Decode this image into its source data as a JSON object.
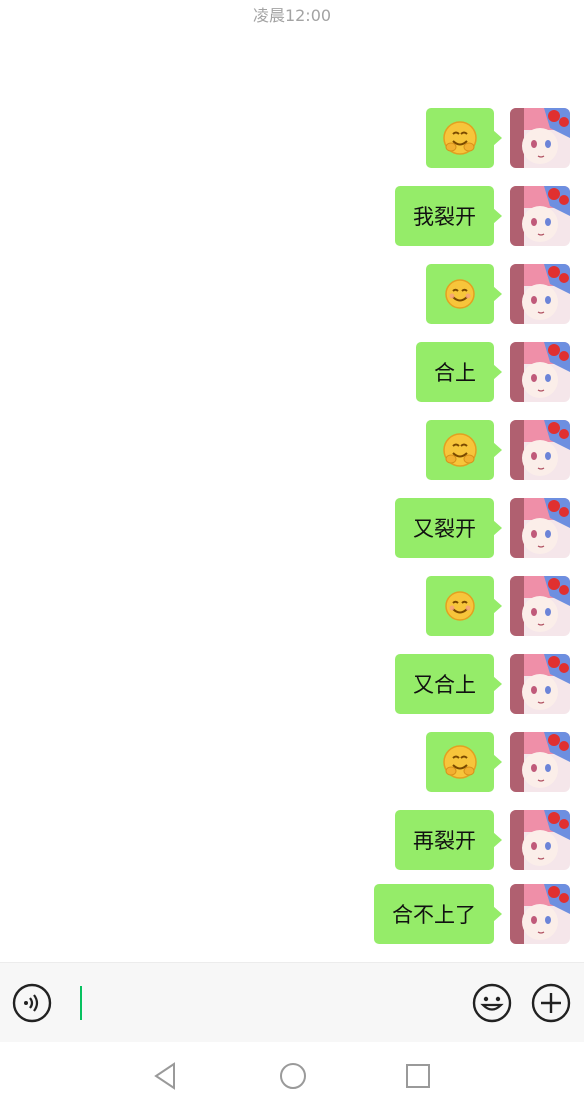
{
  "status": {
    "time": "凌晨12:00"
  },
  "messages": [
    {
      "type": "emoji",
      "emoji": "hugging-face",
      "label": ""
    },
    {
      "type": "text",
      "label": "我裂开"
    },
    {
      "type": "emoji",
      "emoji": "smiling-face",
      "label": ""
    },
    {
      "type": "text",
      "label": "合上"
    },
    {
      "type": "emoji",
      "emoji": "hugging-face",
      "label": ""
    },
    {
      "type": "text",
      "label": "又裂开"
    },
    {
      "type": "emoji",
      "emoji": "smiling-face",
      "label": ""
    },
    {
      "type": "text",
      "label": "又合上"
    },
    {
      "type": "emoji",
      "emoji": "hugging-face",
      "label": ""
    },
    {
      "type": "text",
      "label": "再裂开"
    },
    {
      "type": "text",
      "label": "合不上了"
    }
  ],
  "input": {
    "value": "",
    "placeholder": ""
  },
  "toolbar": {
    "voice_icon": "voice-icon",
    "emoji_icon": "emoji-icon",
    "plus_icon": "plus-icon"
  },
  "nav": {
    "back_icon": "back-icon",
    "home_icon": "home-icon",
    "recents_icon": "recents-icon"
  },
  "colors": {
    "bubble": "#95ec69",
    "cursor": "#07c160",
    "timestamp": "#a3a3a3"
  }
}
